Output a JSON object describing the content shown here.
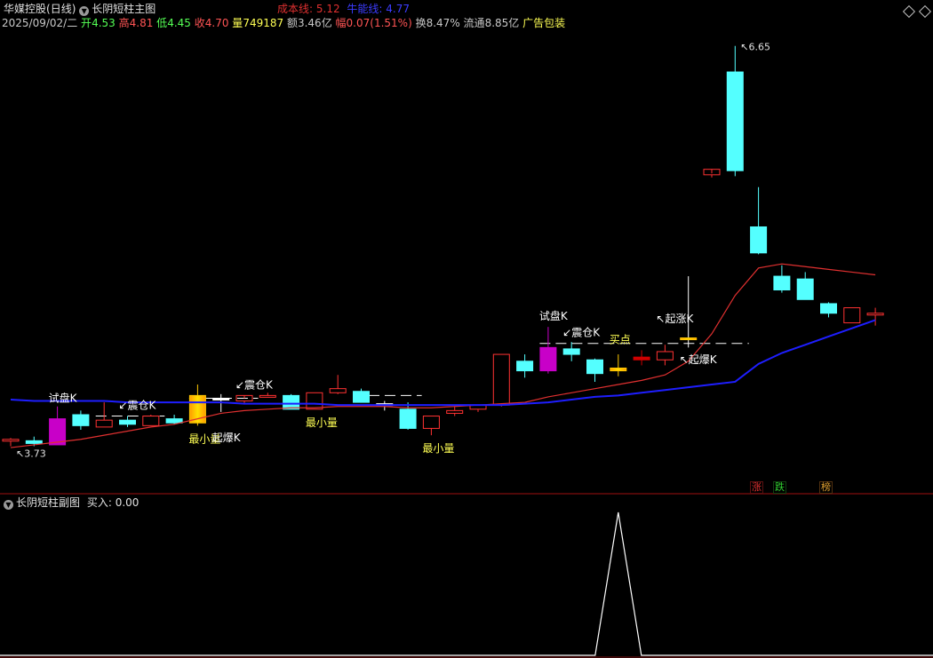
{
  "header": {
    "stock_name": "华媒控股",
    "period": "(日线)",
    "indicator_name": "长阴短柱主图",
    "cost_line_label": "成本线:",
    "cost_line_value": "5.12",
    "bull_line_label": "牛能线:",
    "bull_line_value": "4.77"
  },
  "quote": {
    "date": "2025/09/02/二",
    "open_label": "开",
    "open": "4.53",
    "high_label": "高",
    "high": "4.81",
    "low_label": "低",
    "low": "4.45",
    "close_label": "收",
    "close": "4.70",
    "volume_label": "量",
    "volume": "749187",
    "amount_label": "额",
    "amount": "3.46亿",
    "change_label": "幅",
    "change": "0.07(1.51%)",
    "turnover_label": "换",
    "turnover": "8.47%",
    "float_label": "流通",
    "float_value": "8.85亿",
    "ad_text": "广告包装"
  },
  "chart_data": {
    "type": "candlestick",
    "price_axis": {
      "min": 3.5,
      "max": 6.7
    },
    "price_extremes": {
      "high": "6.65",
      "low": "3.73"
    },
    "candles": [
      {
        "o": 3.78,
        "h": 3.79,
        "l": 3.73,
        "c": 3.78,
        "color": "red"
      },
      {
        "o": 3.77,
        "h": 3.8,
        "l": 3.73,
        "c": 3.75,
        "color": "cyan"
      },
      {
        "o": 3.74,
        "h": 4.02,
        "l": 3.74,
        "c": 3.93,
        "color": "magenta"
      },
      {
        "o": 3.96,
        "h": 3.99,
        "l": 3.85,
        "c": 3.88,
        "color": "cyan"
      },
      {
        "o": 3.87,
        "h": 4.05,
        "l": 3.87,
        "c": 3.92,
        "color": "red"
      },
      {
        "o": 3.92,
        "h": 3.95,
        "l": 3.87,
        "c": 3.89,
        "color": "cyan"
      },
      {
        "o": 3.88,
        "h": 3.96,
        "l": 3.88,
        "c": 3.95,
        "color": "red"
      },
      {
        "o": 3.93,
        "h": 3.96,
        "l": 3.89,
        "c": 3.9,
        "color": "cyan"
      },
      {
        "o": 3.9,
        "h": 4.18,
        "l": 3.88,
        "c": 4.1,
        "color": "gold"
      },
      {
        "o": 4.08,
        "h": 4.11,
        "l": 3.98,
        "c": 4.07,
        "color": "white"
      },
      {
        "o": 4.06,
        "h": 4.08,
        "l": 4.04,
        "c": 4.1,
        "color": "red"
      },
      {
        "o": 4.1,
        "h": 4.12,
        "l": 4.09,
        "c": 4.1,
        "color": "red"
      },
      {
        "o": 4.1,
        "h": 4.11,
        "l": 4.05,
        "c": 4.0,
        "color": "cyan"
      },
      {
        "o": 4.0,
        "h": 4.12,
        "l": 4.0,
        "c": 4.12,
        "color": "red"
      },
      {
        "o": 4.12,
        "h": 4.25,
        "l": 4.11,
        "c": 4.15,
        "color": "red"
      },
      {
        "o": 4.13,
        "h": 4.15,
        "l": 4.05,
        "c": 4.05,
        "color": "cyan"
      },
      {
        "o": 4.04,
        "h": 4.06,
        "l": 3.99,
        "c": 4.03,
        "color": "white"
      },
      {
        "o": 4.0,
        "h": 4.05,
        "l": 3.85,
        "c": 3.86,
        "color": "cyan"
      },
      {
        "o": 3.86,
        "h": 3.95,
        "l": 3.81,
        "c": 3.95,
        "color": "red"
      },
      {
        "o": 3.97,
        "h": 4.02,
        "l": 3.95,
        "c": 3.99,
        "color": "red"
      },
      {
        "o": 4.0,
        "h": 4.03,
        "l": 3.98,
        "c": 4.03,
        "color": "red"
      },
      {
        "o": 4.03,
        "h": 4.4,
        "l": 4.02,
        "c": 4.4,
        "color": "red"
      },
      {
        "o": 4.35,
        "h": 4.4,
        "l": 4.23,
        "c": 4.28,
        "color": "cyan"
      },
      {
        "o": 4.28,
        "h": 4.6,
        "l": 4.26,
        "c": 4.45,
        "color": "magenta"
      },
      {
        "o": 4.44,
        "h": 4.49,
        "l": 4.35,
        "c": 4.4,
        "color": "cyan"
      },
      {
        "o": 4.36,
        "h": 4.37,
        "l": 4.2,
        "c": 4.26,
        "color": "cyan"
      },
      {
        "o": 4.28,
        "h": 4.4,
        "l": 4.24,
        "c": 4.3,
        "color": "gold"
      },
      {
        "o": 4.36,
        "h": 4.43,
        "l": 4.32,
        "c": 4.38,
        "color": "darkred"
      },
      {
        "o": 4.36,
        "h": 4.47,
        "l": 4.32,
        "c": 4.42,
        "color": "red"
      },
      {
        "o": 4.52,
        "h": 4.97,
        "l": 4.45,
        "c": 4.52,
        "color": "gold"
      },
      {
        "o": 5.71,
        "h": 5.72,
        "l": 5.69,
        "c": 5.75,
        "color": "red"
      },
      {
        "o": 6.46,
        "h": 6.65,
        "l": 5.7,
        "c": 5.74,
        "color": "cyan"
      },
      {
        "o": 5.33,
        "h": 5.62,
        "l": 5.13,
        "c": 5.14,
        "color": "cyan"
      },
      {
        "o": 4.97,
        "h": 5.05,
        "l": 4.85,
        "c": 4.87,
        "color": "cyan"
      },
      {
        "o": 4.95,
        "h": 5.0,
        "l": 4.85,
        "c": 4.8,
        "color": "cyan"
      },
      {
        "o": 4.77,
        "h": 4.78,
        "l": 4.67,
        "c": 4.7,
        "color": "cyan"
      },
      {
        "o": 4.63,
        "h": 4.74,
        "l": 4.63,
        "c": 4.74,
        "color": "red"
      },
      {
        "o": 4.69,
        "h": 4.74,
        "l": 4.61,
        "c": 4.7,
        "color": "red"
      }
    ],
    "cost_line": [
      3.72,
      3.74,
      3.76,
      3.78,
      3.81,
      3.84,
      3.87,
      3.89,
      3.93,
      3.97,
      3.99,
      4.0,
      4.01,
      4.01,
      4.02,
      4.02,
      4.02,
      4.01,
      4.01,
      4.02,
      4.03,
      4.04,
      4.05,
      4.09,
      4.12,
      4.15,
      4.18,
      4.21,
      4.25,
      4.35,
      4.55,
      4.83,
      5.03,
      5.06,
      5.04,
      5.02,
      5.0,
      4.98
    ],
    "bull_line": [
      4.07,
      4.06,
      4.06,
      4.06,
      4.06,
      4.05,
      4.05,
      4.05,
      4.05,
      4.05,
      4.04,
      4.04,
      4.04,
      4.04,
      4.03,
      4.03,
      4.03,
      4.03,
      4.03,
      4.03,
      4.03,
      4.03,
      4.04,
      4.05,
      4.07,
      4.09,
      4.1,
      4.12,
      4.14,
      4.16,
      4.18,
      4.2,
      4.33,
      4.41,
      4.47,
      4.53,
      4.59,
      4.65
    ],
    "support_levels": [
      {
        "price": 3.95,
        "from": 4,
        "to": 6
      },
      {
        "price": 4.08,
        "from": 8,
        "to": 10
      },
      {
        "price": 4.1,
        "from": 15,
        "to": 17
      },
      {
        "price": 4.48,
        "from": 23,
        "to": 31
      }
    ],
    "annotations": [
      {
        "text": "试盘K",
        "candle": 2,
        "price": 4.02,
        "pos": "above",
        "color": "white"
      },
      {
        "text": "↙震仓K",
        "candle": 5,
        "price": 3.97,
        "pos": "above",
        "color": "white"
      },
      {
        "text": "最小量",
        "candle": 8,
        "price": 3.86,
        "pos": "below",
        "color": "yellow"
      },
      {
        "text": "起爆K",
        "candle": 9,
        "price": 3.87,
        "pos": "below",
        "color": "white"
      },
      {
        "text": "↙震仓K",
        "candle": 10,
        "price": 4.12,
        "pos": "above",
        "color": "white"
      },
      {
        "text": "最小量",
        "candle": 13,
        "price": 3.98,
        "pos": "below",
        "color": "yellow"
      },
      {
        "text": "最小量",
        "candle": 18,
        "price": 3.79,
        "pos": "below",
        "color": "yellow"
      },
      {
        "text": "试盘K",
        "candle": 23,
        "price": 4.62,
        "pos": "above",
        "color": "white"
      },
      {
        "text": "↙震仓K",
        "candle": 24,
        "price": 4.5,
        "pos": "above",
        "color": "white"
      },
      {
        "text": "买点",
        "candle": 26,
        "price": 4.45,
        "pos": "above",
        "color": "yellow"
      },
      {
        "text": "↖起涨K",
        "candle": 28,
        "price": 4.6,
        "pos": "above",
        "color": "white"
      },
      {
        "text": "↖起爆K",
        "candle": 29,
        "price": 4.44,
        "pos": "below",
        "color": "white"
      }
    ],
    "sub_indicator": {
      "title": "长阴短柱副图",
      "buy_label": "买入:",
      "buy_value": "0.00",
      "spike_candle": 26,
      "spike_value": 1
    }
  },
  "badges": [
    {
      "text": "涨",
      "color": "#e03030"
    },
    {
      "text": "跌",
      "color": "#30d030"
    },
    {
      "text": "榜",
      "color": "#e0a030"
    }
  ],
  "colors": {
    "up_red": "#ff3232",
    "down_cyan": "#54ffff",
    "magenta": "#c800c8",
    "gold": "#ffc800",
    "cost_line": "#e03030",
    "bull_line": "#1e1eff",
    "divider": "#a01010",
    "yellow_text": "#ffff54"
  }
}
